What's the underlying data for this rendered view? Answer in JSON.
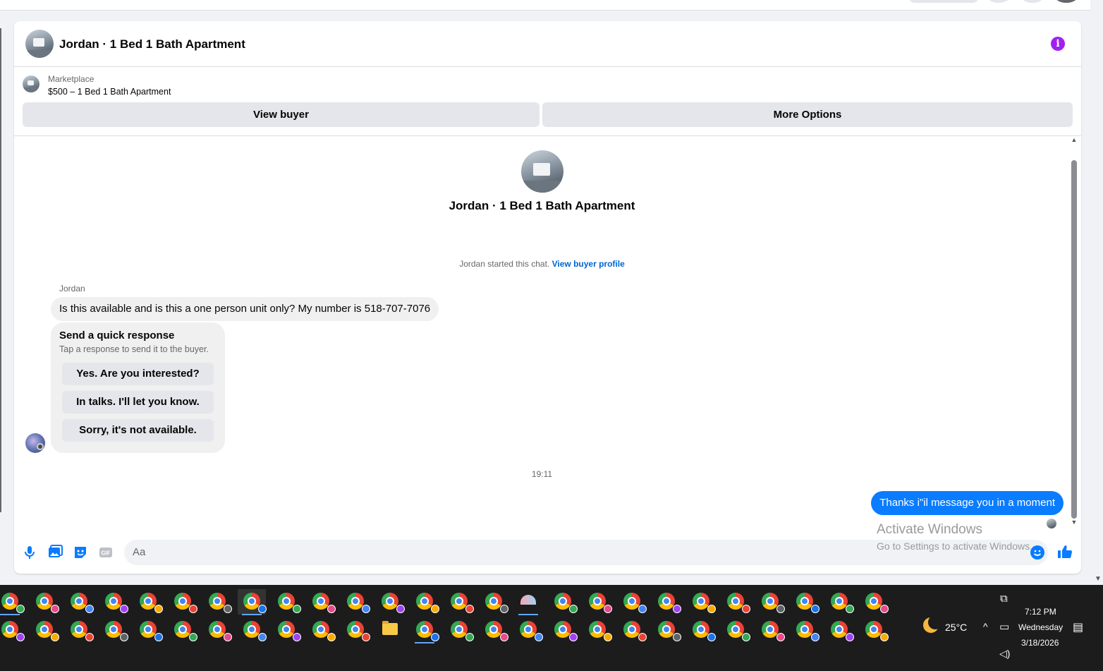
{
  "conversation": {
    "title": "Jordan · 1 Bed 1 Bath Apartment"
  },
  "listing": {
    "source_label": "Marketplace",
    "item": "$500 – 1 Bed 1 Bath Apartment"
  },
  "actions": {
    "view_buyer": "View buyer",
    "more_options": "More Options"
  },
  "chat": {
    "profile_title": "Jordan · 1 Bed 1 Bath Apartment",
    "started_text": "Jordan started this chat.",
    "view_profile_link": "View buyer profile",
    "sender_name": "Jordan",
    "incoming_message": "Is this available and is this a one person unit only? My number is 518-707-7076",
    "quick_response": {
      "heading": "Send a quick response",
      "subtext": "Tap a response to send it to the buyer.",
      "options": [
        "Yes. Are you interested?",
        "In talks. I'll let you know.",
        "Sorry, it's not available."
      ]
    },
    "timestamp": "19:11",
    "outgoing_message": "Thanks i\"il message you in a moment"
  },
  "composer": {
    "placeholder": "Aa",
    "gif_label": "GIF"
  },
  "watermark": {
    "line1": "Activate Windows",
    "line2": "Go to Settings to activate Windows."
  },
  "taskbar": {
    "weather_temp": "25°C",
    "time": "7:12 PM",
    "day": "Wednesday",
    "date": "3/18/2026"
  },
  "colors": {
    "accent_blue": "#0a7cff",
    "info_purple": "#a020f0",
    "taskbar_bg": "#1c1c1c"
  },
  "icons": {
    "composer": [
      "microphone-icon",
      "image-icon",
      "sticker-icon",
      "gif-icon",
      "emoji-icon",
      "thumbs-up-icon"
    ],
    "header": [
      "info-icon"
    ],
    "tray": [
      "weather-icon",
      "chevron-up-icon",
      "network-icon",
      "volume-icon",
      "notification-icon",
      "meet-icon"
    ]
  }
}
